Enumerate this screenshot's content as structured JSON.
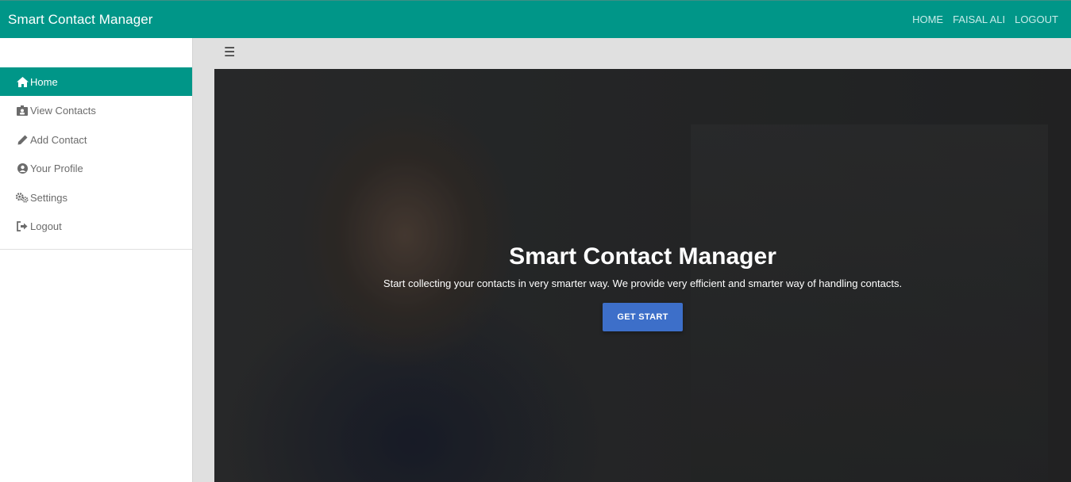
{
  "navbar": {
    "brand": "Smart Contact Manager",
    "links": [
      "HOME",
      "FAISAL ALI",
      "LOGOUT"
    ],
    "color": "#009688"
  },
  "sidebar": {
    "items": [
      {
        "label": "Home",
        "icon": "home-icon",
        "active": true
      },
      {
        "label": "View Contacts",
        "icon": "id-card-icon",
        "active": false
      },
      {
        "label": "Add Contact",
        "icon": "pencil-icon",
        "active": false
      },
      {
        "label": "Your Profile",
        "icon": "user-circle-icon",
        "active": false
      },
      {
        "label": "Settings",
        "icon": "cogs-icon",
        "active": false
      },
      {
        "label": "Logout",
        "icon": "sign-out-icon",
        "active": false
      }
    ]
  },
  "content": {
    "menu_toggle": "☰"
  },
  "hero": {
    "title": "Smart Contact Manager",
    "subtitle": "Start collecting your contacts in very smarter way. We provide very efficient and smarter way of handling contacts.",
    "button": "GET START",
    "button_color": "#3d6fc9"
  }
}
